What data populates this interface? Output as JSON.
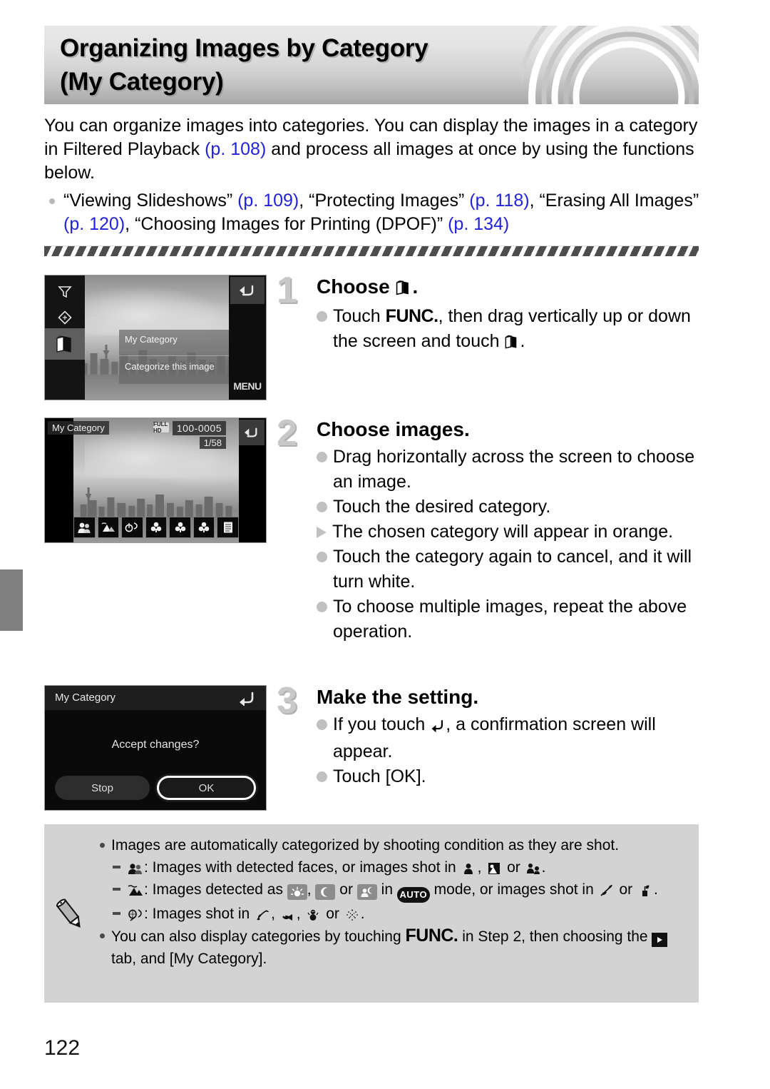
{
  "header": {
    "title_line1": "Organizing Images by Category",
    "title_line2": "(My Category)"
  },
  "intro": {
    "p1_a": "You can organize images into categories. You can display the images in a category in Filtered Playback ",
    "p1_link": "(p. 108)",
    "p1_b": " and process all images at once by using the functions below.",
    "bullet1_a": "“Viewing Slideshows” ",
    "bullet1_link1": "(p. 109)",
    "bullet1_b": ", “Protecting Images” ",
    "bullet1_link2": "(p. 118)",
    "bullet1_c": ", “Erasing All Images” ",
    "bullet1_link3": "(p. 120)",
    "bullet1_d": ", “Choosing Images for Printing (DPOF)” ",
    "bullet1_link4": "(p. 134)"
  },
  "steps": [
    {
      "number": "1",
      "heading_prefix": "Choose",
      "heading_suffix": ".",
      "items": [
        {
          "bullet": "dot",
          "prefix": "Touch ",
          "func": "FUNC.",
          "middle": ", then drag vertically up or down the screen and touch ",
          "suffix": "."
        }
      ]
    },
    {
      "number": "2",
      "heading": "Choose images.",
      "items": [
        {
          "bullet": "dot",
          "text": "Drag horizontally across the screen to choose an image."
        },
        {
          "bullet": "dot",
          "text": "Touch the desired category."
        },
        {
          "bullet": "triangle",
          "text": "The chosen category will appear in orange."
        },
        {
          "bullet": "dot",
          "text": "Touch the category again to cancel, and it will turn white."
        },
        {
          "bullet": "dot",
          "text": "To choose multiple images, repeat the above operation."
        }
      ]
    },
    {
      "number": "3",
      "heading": "Make the setting.",
      "items": [
        {
          "bullet": "dot",
          "prefix": "If you touch ",
          "suffix": ", a confirmation screen will appear."
        },
        {
          "bullet": "dot",
          "text": "Touch [OK]."
        }
      ]
    }
  ],
  "screenshots": {
    "shot1": {
      "panel_title": "My Category",
      "panel_item": "Categorize this image",
      "menu_label": "MENU",
      "back_icon": "back-arrow-icon",
      "left_icons": [
        "filter-icon",
        "rotate-icon",
        "my-category-icon"
      ]
    },
    "shot2": {
      "title": "My Category",
      "file_number": "100-0005",
      "image_count": "1/58",
      "badge": "FULL HD",
      "back_icon": "back-arrow-icon",
      "categories": [
        "people-category-icon",
        "scenery-category-icon",
        "events-category-icon",
        "category-1-icon",
        "category-2-icon",
        "category-3-icon",
        "to-do-list-icon"
      ]
    },
    "shot3": {
      "title": "My Category",
      "message": "Accept changes?",
      "button_stop": "Stop",
      "button_ok": "OK",
      "back_icon": "back-arrow-icon"
    }
  },
  "notes": {
    "icon": "pencil-icon",
    "items": [
      {
        "bullet": "dot",
        "text": "Images are automatically categorized by shooting condition as they are shot."
      },
      {
        "bullet": "dash",
        "prefix": ": Images with detected faces, or images shot in ",
        "mid1": ", ",
        "mid2": " or ",
        "suffix": "."
      },
      {
        "bullet": "dash",
        "prefix": ": Images detected as ",
        "mid1": ", ",
        "mid2": " or ",
        "mid3": " in ",
        "auto": "AUTO",
        "mid4": " mode, or images shot in ",
        "mid5": " or ",
        "suffix": "."
      },
      {
        "bullet": "dash",
        "prefix": ": Images shot in ",
        "mid1": ", ",
        "mid2": ", ",
        "mid3": " or ",
        "suffix": "."
      },
      {
        "bullet": "dot",
        "prefix": "You can also display categories by touching ",
        "func": "FUNC.",
        "mid1": " in Step 2, then choosing the ",
        "mid2": " tab, and [My Category]."
      }
    ]
  },
  "page_number": "122"
}
